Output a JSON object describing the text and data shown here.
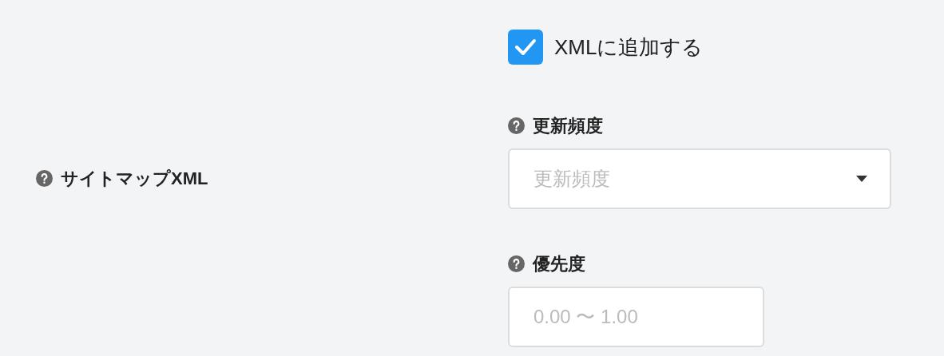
{
  "field_label": "サイトマップXML",
  "add_to_xml": {
    "label": "XMLに追加する",
    "checked": true
  },
  "frequency": {
    "label": "更新頻度",
    "placeholder": "更新頻度"
  },
  "priority": {
    "label": "優先度",
    "placeholder": "0.00 〜 1.00"
  }
}
